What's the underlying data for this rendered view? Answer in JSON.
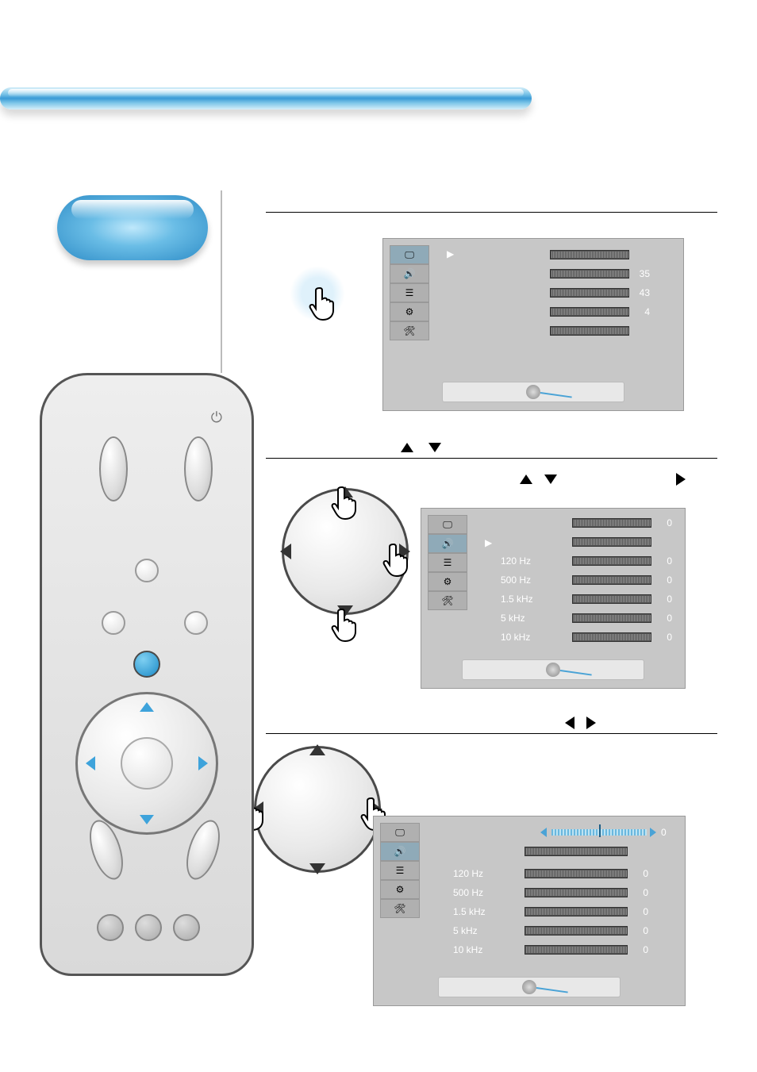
{
  "osd1": {
    "rows": [
      {
        "label": "",
        "value": "35"
      },
      {
        "label": "",
        "value": "43"
      },
      {
        "label": "",
        "value": "4"
      },
      {
        "label": "",
        "value": ""
      }
    ]
  },
  "osd2": {
    "rows": [
      {
        "label": "",
        "value": "0"
      },
      {
        "label": "",
        "value": ""
      },
      {
        "label": "120 Hz",
        "value": "0"
      },
      {
        "label": "500 Hz",
        "value": "0"
      },
      {
        "label": "1.5 kHz",
        "value": "0"
      },
      {
        "label": "5   kHz",
        "value": "0"
      },
      {
        "label": "10  kHz",
        "value": "0"
      }
    ]
  },
  "osd3": {
    "slider_value": "0",
    "rows": [
      {
        "label": "",
        "value": ""
      },
      {
        "label": "120 Hz",
        "value": "0"
      },
      {
        "label": "500 Hz",
        "value": "0"
      },
      {
        "label": "1.5 kHz",
        "value": "0"
      },
      {
        "label": "5   kHz",
        "value": "0"
      },
      {
        "label": "10  kHz",
        "value": "0"
      }
    ]
  }
}
